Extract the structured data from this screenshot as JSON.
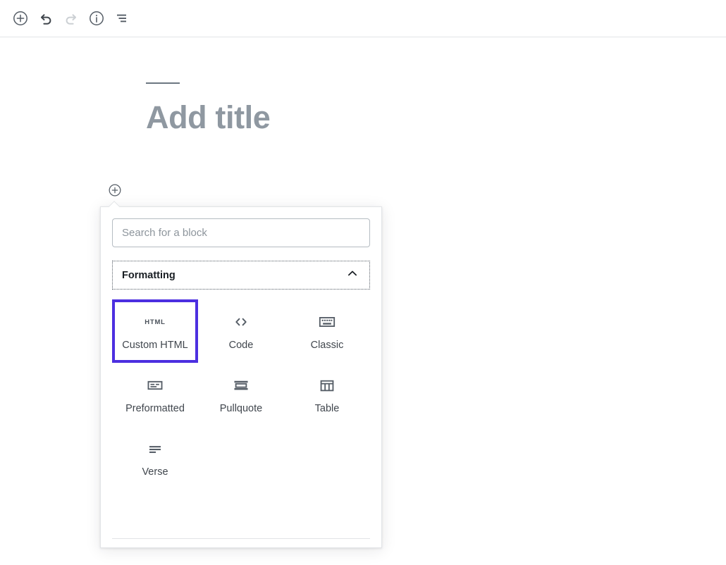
{
  "toolbar": {
    "buttons": [
      {
        "name": "add-block-button",
        "icon": "plus-circle-icon",
        "label": "Add block",
        "disabled": false
      },
      {
        "name": "undo-button",
        "icon": "undo-icon",
        "label": "Undo",
        "disabled": false
      },
      {
        "name": "redo-button",
        "icon": "redo-icon",
        "label": "Redo",
        "disabled": true
      },
      {
        "name": "details-button",
        "icon": "info-icon",
        "label": "Content structure",
        "disabled": false
      },
      {
        "name": "block-navigation-button",
        "icon": "list-view-icon",
        "label": "Block navigation",
        "disabled": false
      }
    ]
  },
  "editor": {
    "title_placeholder": "Add title"
  },
  "inserter": {
    "toggle_label": "Add block",
    "toggle_icon": "plus-circle-icon",
    "search": {
      "placeholder": "Search for a block",
      "value": ""
    },
    "panel": {
      "title": "Formatting",
      "expanded": true,
      "chevron_icon": "chevron-up-icon"
    },
    "blocks": [
      {
        "label": "Custom HTML",
        "icon": "html-icon",
        "selected": true
      },
      {
        "label": "Code",
        "icon": "code-icon",
        "selected": false
      },
      {
        "label": "Classic",
        "icon": "keyboard-icon",
        "selected": false
      },
      {
        "label": "Preformatted",
        "icon": "preformatted-icon",
        "selected": false
      },
      {
        "label": "Pullquote",
        "icon": "pullquote-icon",
        "selected": false
      },
      {
        "label": "Table",
        "icon": "table-icon",
        "selected": false
      },
      {
        "label": "Verse",
        "icon": "verse-icon",
        "selected": false
      }
    ]
  },
  "colors": {
    "selection_purple": "#4c2fe0",
    "icon_gray": "#555d66",
    "placeholder_gray": "#8f98a1",
    "border_gray": "#e2e4e7"
  }
}
